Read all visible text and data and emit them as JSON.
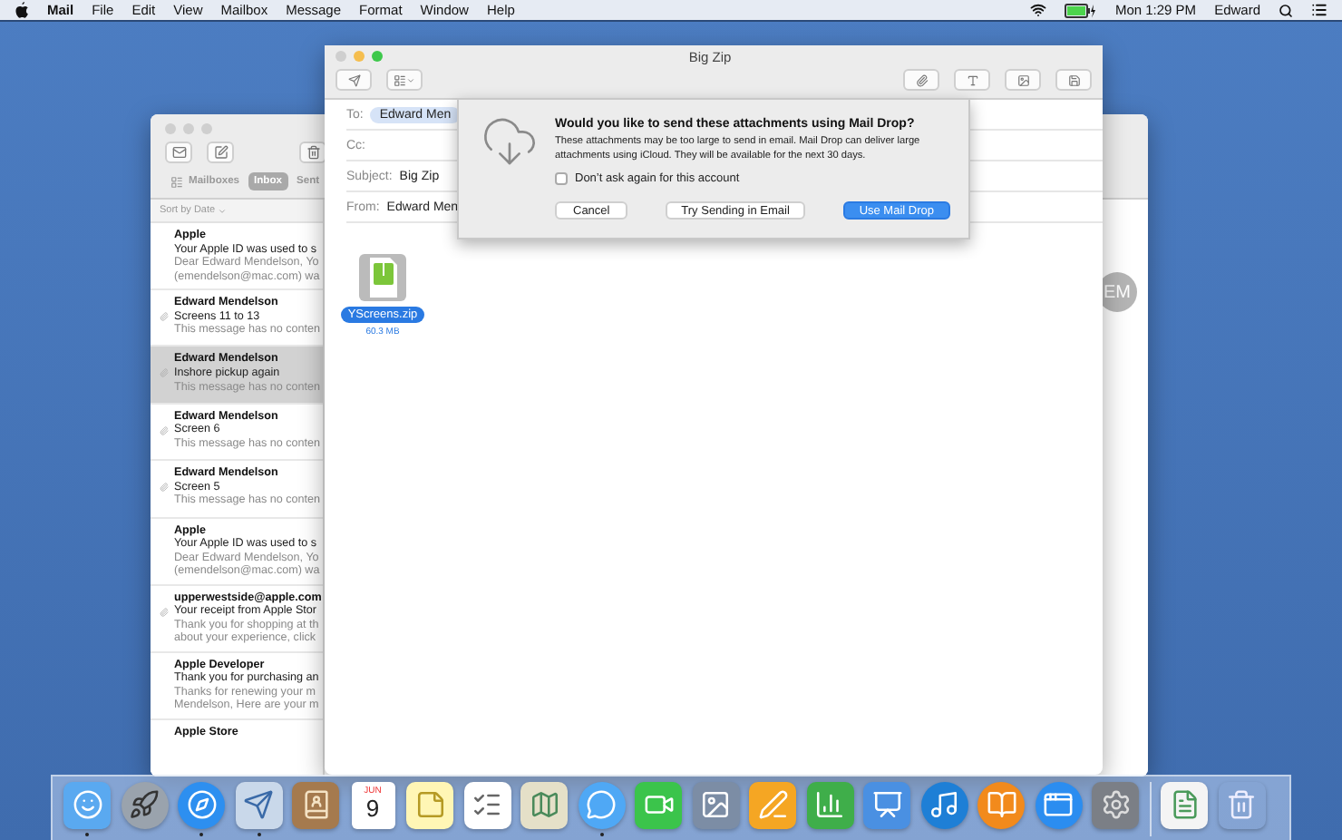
{
  "menu_bar": {
    "app": "Mail",
    "items": [
      "File",
      "Edit",
      "View",
      "Mailbox",
      "Message",
      "Format",
      "Window",
      "Help"
    ],
    "clock": "Mon 1:29 PM",
    "user": "Edward"
  },
  "mail_window": {
    "tabs": [
      {
        "label": "Mailboxes",
        "selected": false
      },
      {
        "label": "Inbox",
        "selected": true
      },
      {
        "label": "Sent",
        "selected": false
      }
    ],
    "sort_label": "Sort by Date",
    "avatar": "EM",
    "messages": [
      {
        "sender": "Apple",
        "subject": "Your Apple ID was used to s",
        "preview": [
          "Dear Edward Mendelson, Yo",
          "(emendelson@mac.com) wa"
        ],
        "attachment": false,
        "selected": false
      },
      {
        "sender": "Edward Mendelson",
        "subject": "Screens 11 to 13",
        "preview": [
          "This message has no conten"
        ],
        "attachment": true,
        "selected": false
      },
      {
        "sender": "Edward Mendelson",
        "subject": "Inshore pickup again",
        "preview": [
          "This message has no conten"
        ],
        "attachment": true,
        "selected": true
      },
      {
        "sender": "Edward Mendelson",
        "subject": "Screen 6",
        "preview": [
          "This message has no conten"
        ],
        "attachment": true,
        "selected": false
      },
      {
        "sender": "Edward Mendelson",
        "subject": "Screen 5",
        "preview": [
          "This message has no conten"
        ],
        "attachment": true,
        "selected": false
      },
      {
        "sender": "Apple",
        "subject": "Your Apple ID was used to s",
        "preview": [
          "Dear Edward Mendelson, Yo",
          "(emendelson@mac.com) wa"
        ],
        "attachment": false,
        "selected": false
      },
      {
        "sender": "upperwestside@apple.com",
        "subject": "Your receipt from Apple Stor",
        "preview": [
          "Thank you for shopping at th",
          "about your experience, click"
        ],
        "attachment": true,
        "selected": false
      },
      {
        "sender": "Apple Developer",
        "subject": "Thank you for purchasing an",
        "preview": [
          "Thanks for renewing your m",
          "Mendelson, Here are your m"
        ],
        "attachment": false,
        "selected": false
      },
      {
        "sender": "Apple Store",
        "attachment": false,
        "selected": false
      }
    ]
  },
  "compose": {
    "title": "Big Zip",
    "fields": [
      {
        "label": "To:",
        "value": "Edward Men",
        "kind": "token"
      },
      {
        "label": "Cc:"
      },
      {
        "label": "Subject:",
        "value": "Big Zip",
        "kind": "text"
      },
      {
        "label": "From:",
        "value": "Edward Men",
        "kind": "text"
      }
    ],
    "attachment": {
      "name": "YScreens.zip",
      "size": "60.3 MB",
      "selected": true
    }
  },
  "dialog": {
    "title": "Would you like to send these attachments using Mail Drop?",
    "message": "These attachments may be too large to send in email. Mail Drop can deliver large attachments using iCloud. They will be available for the next 30 days.",
    "checkbox": {
      "label": "Don’t ask again for this account",
      "checked": false
    },
    "buttons": [
      {
        "label": "Cancel",
        "default": false
      },
      {
        "label": "Try Sending in Email",
        "default": false
      },
      {
        "label": "Use Mail Drop",
        "default": true
      }
    ]
  },
  "dock": {
    "items": [
      {
        "kind": "finder",
        "running": true
      },
      {
        "kind": "launchpad",
        "running": false
      },
      {
        "kind": "safari",
        "running": true
      },
      {
        "kind": "mail",
        "running": true
      },
      {
        "kind": "contacts",
        "running": false
      },
      {
        "kind": "calendar",
        "month": "JUN",
        "day": "9",
        "running": false
      },
      {
        "kind": "notes",
        "running": false
      },
      {
        "kind": "reminders",
        "running": false
      },
      {
        "kind": "maps",
        "running": false
      },
      {
        "kind": "messages",
        "running": true
      },
      {
        "kind": "facetime",
        "running": false
      },
      {
        "kind": "photos",
        "running": false
      },
      {
        "kind": "pages",
        "running": false
      },
      {
        "kind": "numbers",
        "running": false
      },
      {
        "kind": "keynote",
        "running": false
      },
      {
        "kind": "itunes",
        "running": false
      },
      {
        "kind": "ibooks",
        "running": false
      },
      {
        "kind": "appstore",
        "running": false
      },
      {
        "kind": "settings",
        "running": false
      },
      {
        "kind": "separator"
      },
      {
        "kind": "document",
        "running": false
      },
      {
        "kind": "trash",
        "running": false
      }
    ]
  }
}
